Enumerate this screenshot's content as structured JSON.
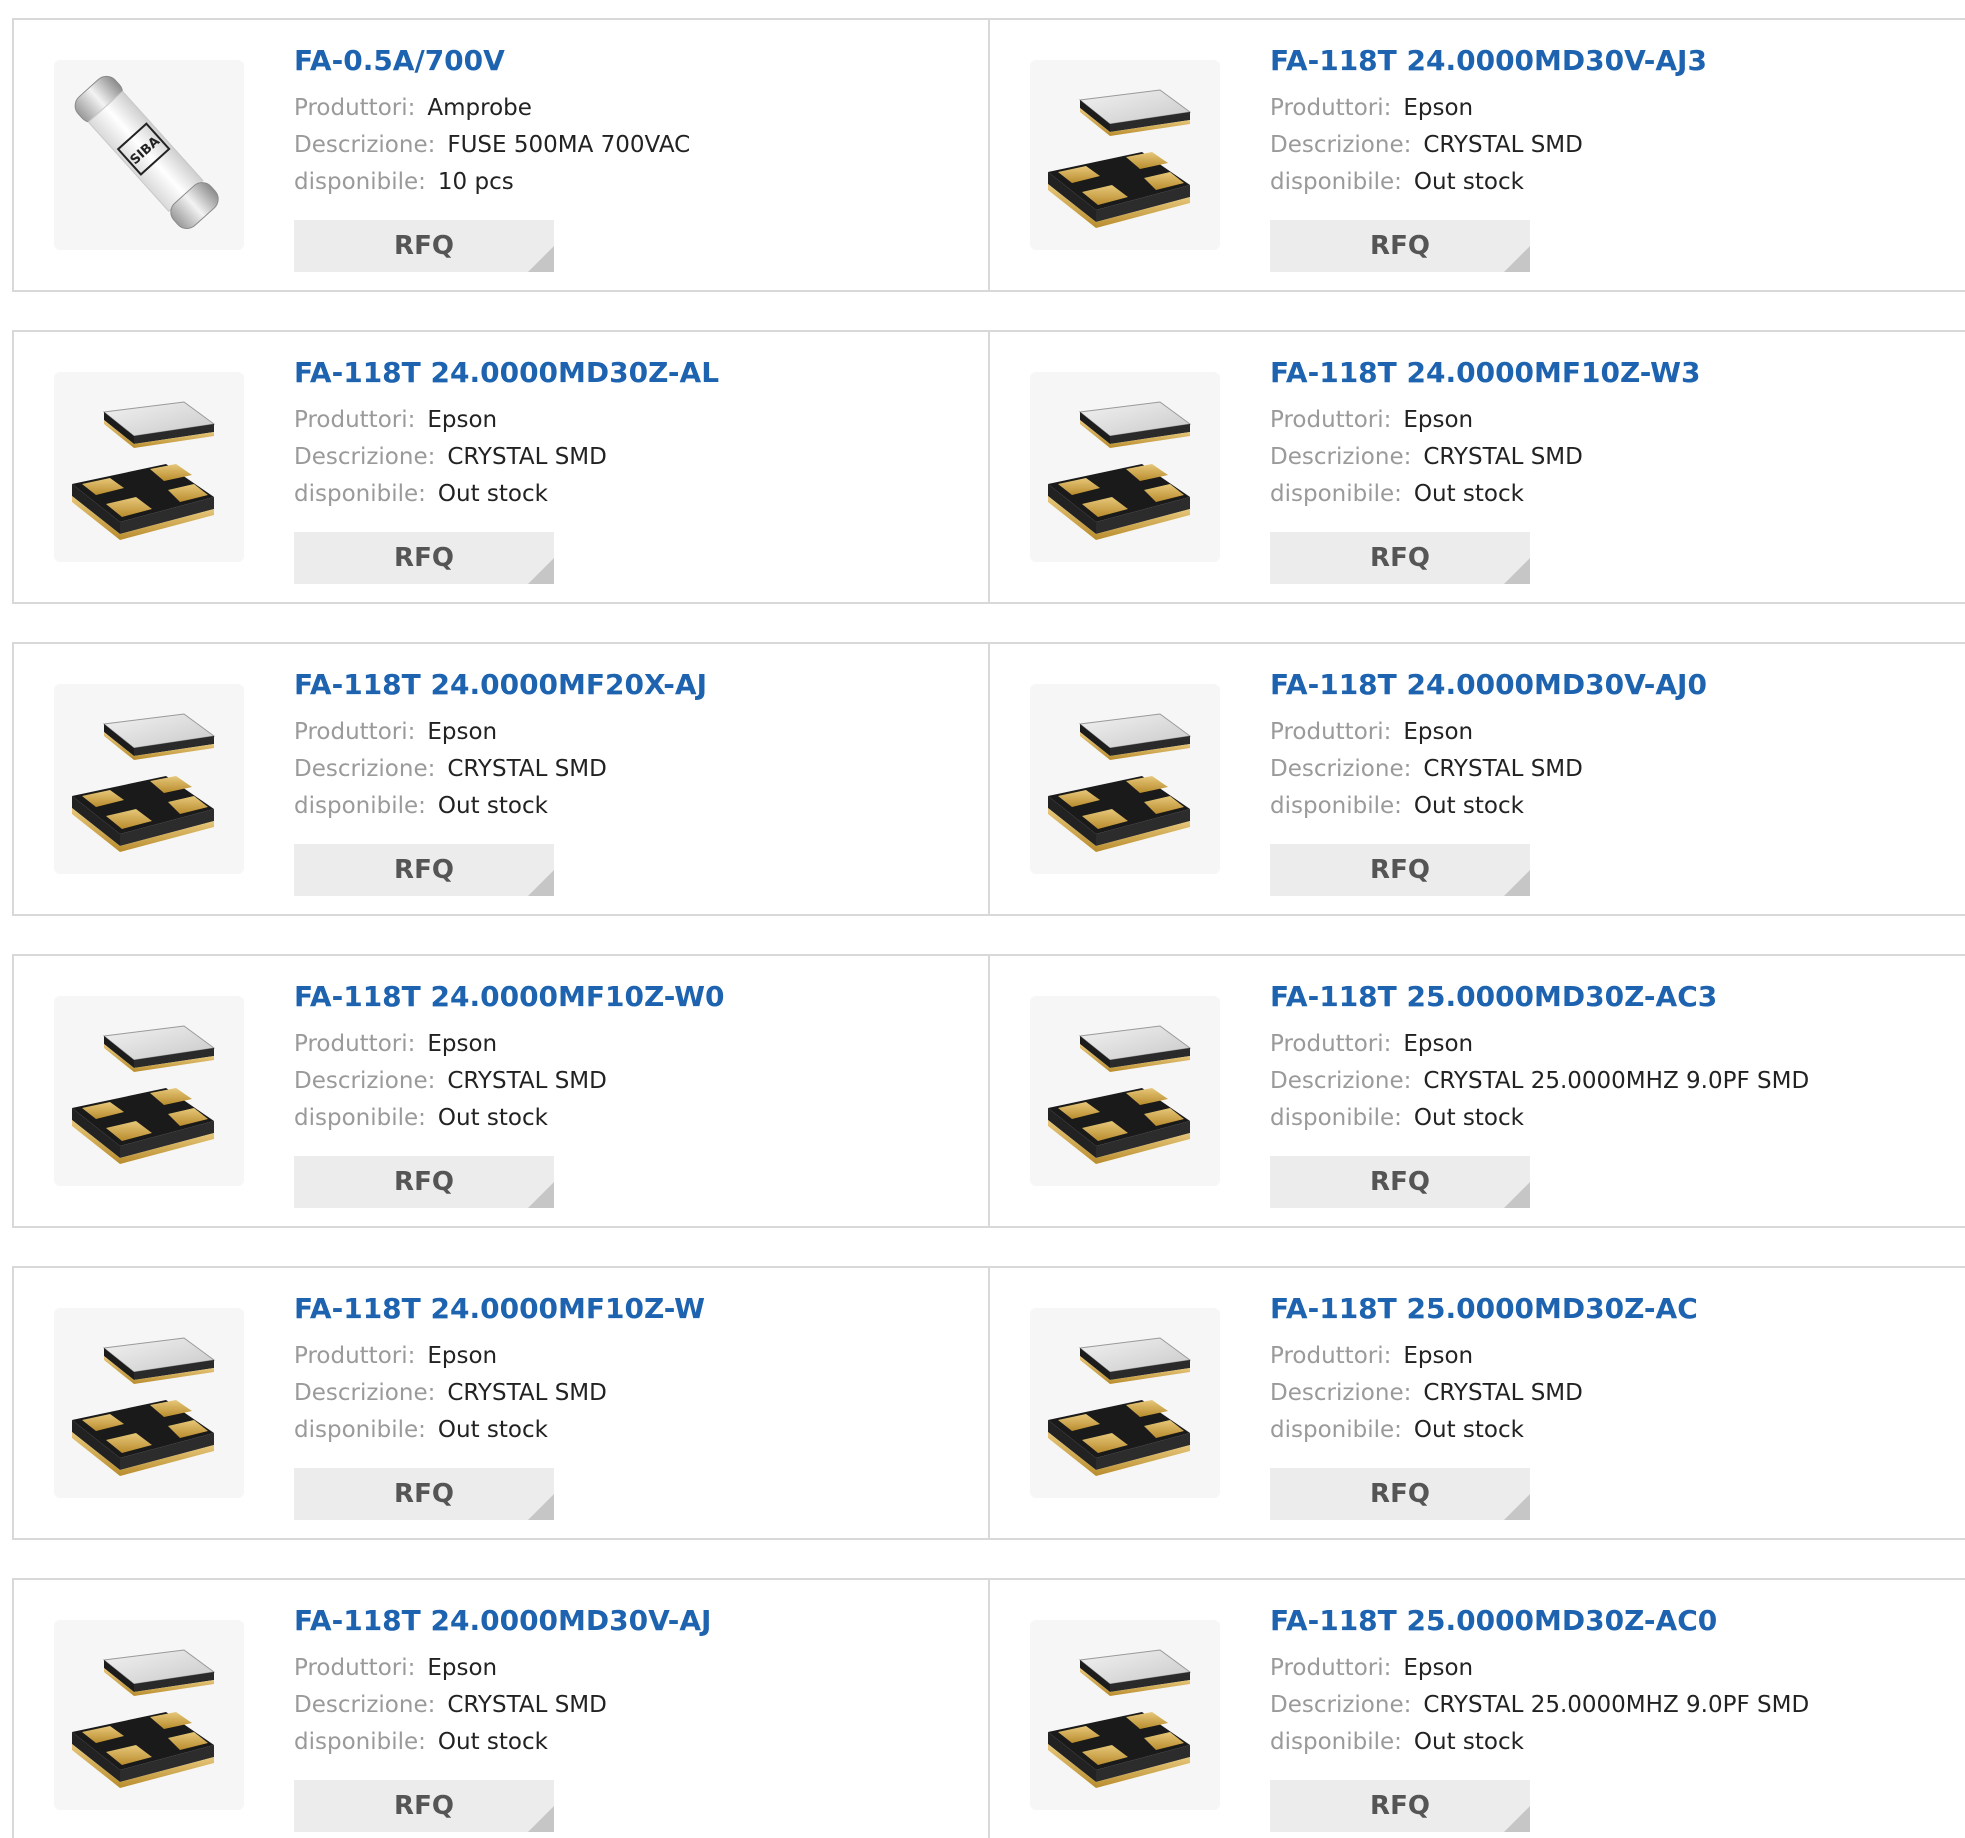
{
  "labels": {
    "manufacturer": "Produttori:",
    "description": "Descrizione:",
    "availability": "disponibile:",
    "rfq": "RFQ"
  },
  "products": [
    {
      "part": "FA-0.5A/700V",
      "manufacturer": "Amprobe",
      "description": "FUSE 500MA 700VAC",
      "availability": "10 pcs",
      "image": "fuse-icon"
    },
    {
      "part": "FA-118T 24.0000MD30V-AJ3",
      "manufacturer": "Epson",
      "description": "CRYSTAL SMD",
      "availability": "Out stock",
      "image": "crystal-smd-icon"
    },
    {
      "part": "FA-118T 24.0000MD30Z-AL",
      "manufacturer": "Epson",
      "description": "CRYSTAL SMD",
      "availability": "Out stock",
      "image": "crystal-smd-icon"
    },
    {
      "part": "FA-118T 24.0000MF10Z-W3",
      "manufacturer": "Epson",
      "description": "CRYSTAL SMD",
      "availability": "Out stock",
      "image": "crystal-smd-icon"
    },
    {
      "part": "FA-118T 24.0000MF20X-AJ",
      "manufacturer": "Epson",
      "description": "CRYSTAL SMD",
      "availability": "Out stock",
      "image": "crystal-smd-icon"
    },
    {
      "part": "FA-118T 24.0000MD30V-AJ0",
      "manufacturer": "Epson",
      "description": "CRYSTAL SMD",
      "availability": "Out stock",
      "image": "crystal-smd-icon"
    },
    {
      "part": "FA-118T 24.0000MF10Z-W0",
      "manufacturer": "Epson",
      "description": "CRYSTAL SMD",
      "availability": "Out stock",
      "image": "crystal-smd-icon"
    },
    {
      "part": "FA-118T 25.0000MD30Z-AC3",
      "manufacturer": "Epson",
      "description": "CRYSTAL 25.0000MHZ 9.0PF SMD",
      "availability": "Out stock",
      "image": "crystal-smd-icon"
    },
    {
      "part": "FA-118T 24.0000MF10Z-W",
      "manufacturer": "Epson",
      "description": "CRYSTAL SMD",
      "availability": "Out stock",
      "image": "crystal-smd-icon"
    },
    {
      "part": "FA-118T 25.0000MD30Z-AC",
      "manufacturer": "Epson",
      "description": "CRYSTAL SMD",
      "availability": "Out stock",
      "image": "crystal-smd-icon"
    },
    {
      "part": "FA-118T 24.0000MD30V-AJ",
      "manufacturer": "Epson",
      "description": "CRYSTAL SMD",
      "availability": "Out stock",
      "image": "crystal-smd-icon"
    },
    {
      "part": "FA-118T 25.0000MD30Z-AC0",
      "manufacturer": "Epson",
      "description": "CRYSTAL 25.0000MHZ 9.0PF SMD",
      "availability": "Out stock",
      "image": "crystal-smd-icon"
    }
  ],
  "fuse_logo_text": "SIBA",
  "colors": {
    "title_link": "#1d63b0",
    "label_gray": "#9a9a9a",
    "rfq_bg": "#ececec",
    "border": "#d8d8d8"
  }
}
